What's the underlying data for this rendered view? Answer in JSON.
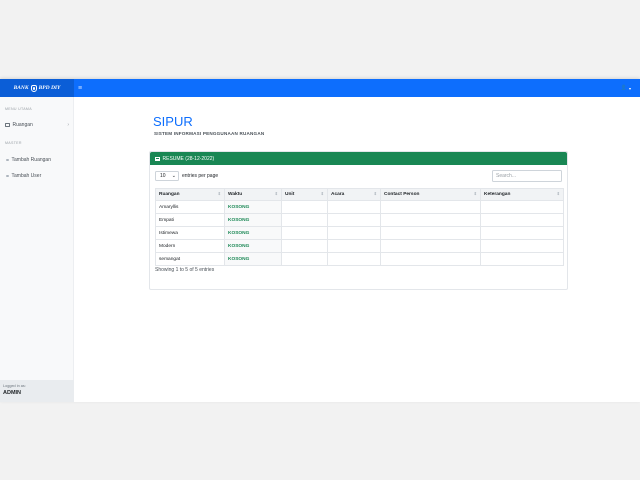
{
  "brand": {
    "text": "BANK",
    "suffix": "BPD DIY"
  },
  "nav": {
    "toggle_glyph": "≡",
    "user_glyph": "👤",
    "caret_glyph": "▾"
  },
  "sidebar": {
    "heading_menu": "MENU UTAMA",
    "heading_master": "MASTER",
    "items": [
      {
        "label": "Ruangan",
        "icon": "table-icon",
        "chevron": "›"
      },
      {
        "label": "Tambah Ruangan",
        "icon": "dot-icon"
      },
      {
        "label": "Tambah User",
        "icon": "dot-icon"
      }
    ],
    "footer": {
      "logged_in_as": "Logged in as:",
      "user": "ADMIN"
    }
  },
  "page": {
    "title": "SIPUR",
    "subtitle": "SISTEM INFORMASI PENGGUNAAN RUANGAN"
  },
  "card": {
    "header": "RESUME (28-12-2022)",
    "length_value": "10",
    "length_caret": "⌄",
    "length_label": "entries per page",
    "search_placeholder": "Search...",
    "columns": [
      "Ruangan",
      "Waktu",
      "Unit",
      "Acara",
      "Contact Person",
      "Keterangan"
    ],
    "sort_glyph": "⇕",
    "rows": [
      {
        "ruangan": "Amaryllis",
        "waktu": "KOSONG",
        "unit": "",
        "acara": "",
        "contact": "",
        "keterangan": ""
      },
      {
        "ruangan": "Empati",
        "waktu": "KOSONG",
        "unit": "",
        "acara": "",
        "contact": "",
        "keterangan": ""
      },
      {
        "ruangan": "Istimewa",
        "waktu": "KOSONG",
        "unit": "",
        "acara": "",
        "contact": "",
        "keterangan": ""
      },
      {
        "ruangan": "Modern",
        "waktu": "KOSONG",
        "unit": "",
        "acara": "",
        "contact": "",
        "keterangan": ""
      },
      {
        "ruangan": "semangat",
        "waktu": "KOSONG",
        "unit": "",
        "acara": "",
        "contact": "",
        "keterangan": ""
      }
    ],
    "info": "Showing 1 to 5 of 5 entries"
  },
  "colors": {
    "primary": "#0d6efd",
    "success": "#198754"
  }
}
